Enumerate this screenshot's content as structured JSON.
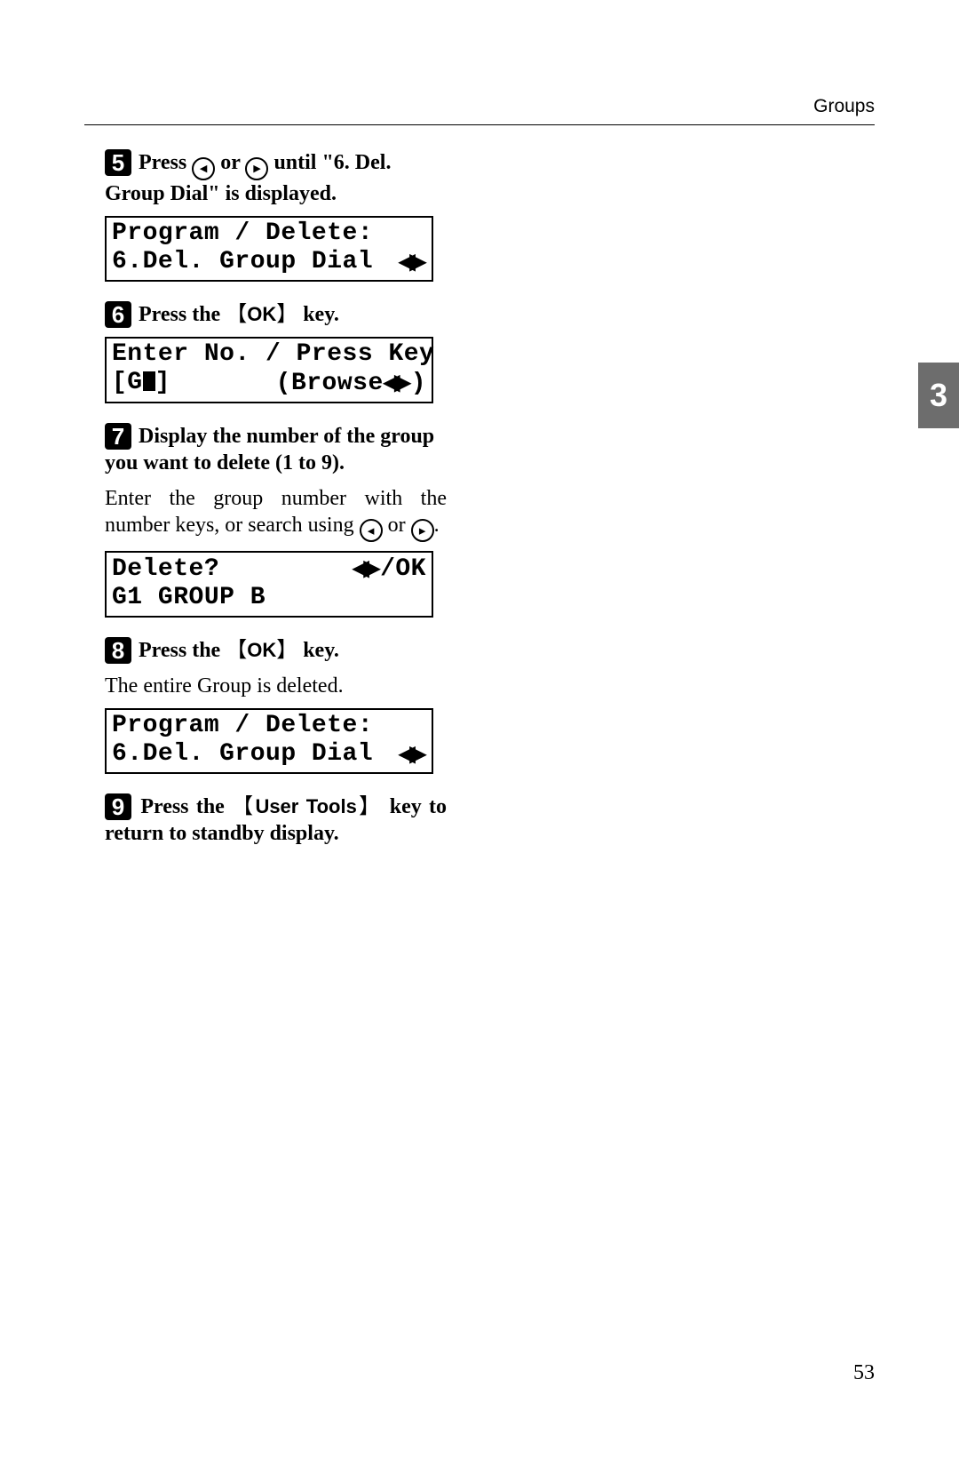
{
  "header": {
    "section_title": "Groups"
  },
  "side_tab": {
    "chapter": "3"
  },
  "page_number": "53",
  "steps": {
    "s5": {
      "num": "5",
      "bold_a": "Press ",
      "bold_b": " or ",
      "bold_c": " until \"6. Del. Group Dial\" is displayed."
    },
    "s6": {
      "num": "6",
      "bold_a": "Press the ",
      "key": "OK",
      "bold_b": " key."
    },
    "s7": {
      "num": "7",
      "bold": "Display the number of the group you want to delete (1 to 9).",
      "body_a": "Enter the group number with the number keys, or search using ",
      "body_b": " or ",
      "body_c": "."
    },
    "s8": {
      "num": "8",
      "bold_a": "Press the ",
      "key": "OK",
      "bold_b": " key.",
      "body": "The entire Group is deleted."
    },
    "s9": {
      "num": "9",
      "bold_a": "Press the ",
      "key": "User Tools",
      "bold_b": " key to return to standby display."
    }
  },
  "lcd": {
    "d1": {
      "line1": "Program / Delete:",
      "line2_left": "6.Del. Group Dial"
    },
    "d2": {
      "line1": "Enter No. / Press Key",
      "line2_left": "[G",
      "line2_left_suffix": "]",
      "line2_right_prefix": "(Browse",
      "line2_right_suffix": ")"
    },
    "d3": {
      "line1_left": "Delete?",
      "line1_right": "/OK",
      "line2": "G1 GROUP B"
    },
    "d4": {
      "line1": "Program / Delete:",
      "line2_left": "6.Del. Group Dial"
    }
  }
}
